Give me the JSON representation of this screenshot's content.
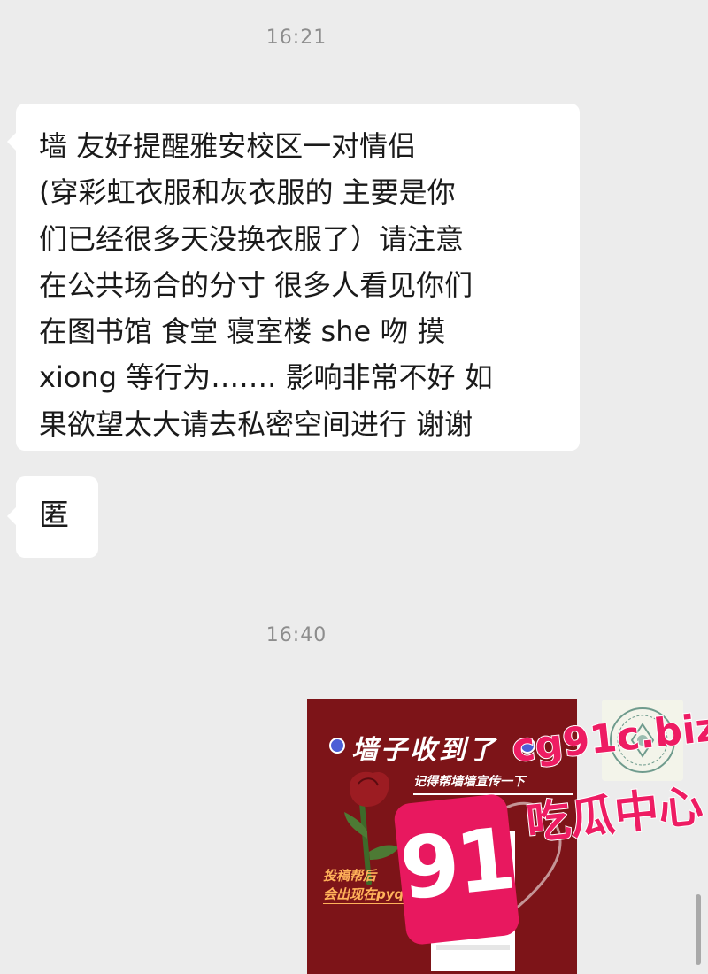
{
  "chat": {
    "timestamps": [
      "16:21",
      "16:40"
    ],
    "messages": [
      {
        "side": "left",
        "text": "墙 友好提醒雅安校区一对情侣\n(穿彩虹衣服和灰衣服的 主要是你\n们已经很多天没换衣服了）请注意\n在公共场合的分寸 很多人看见你们\n在图书馆 食堂 寝室楼 she 吻 摸\nxiong 等行为……. 影响非常不好 如\n果欲望太大请去私密空间进行 谢谢"
      },
      {
        "side": "left",
        "text": "匿"
      },
      {
        "side": "right",
        "type": "image",
        "image": {
          "title": "墙子收到了",
          "subtitle": "记得帮墙墙宣传一下",
          "caption_lines": [
            "投稿帮后",
            "会出现在pyq"
          ],
          "background": "#7d1418"
        }
      }
    ]
  },
  "watermark": {
    "badge": "91",
    "domain": "cg91c.biz",
    "center": "吃瓜中心",
    "color": "#e8185f"
  },
  "icons": {
    "rose": "rose-icon",
    "qr": "qr-code-icon",
    "avatar": "avatar-icon",
    "title_flowers": "flower-icon"
  }
}
